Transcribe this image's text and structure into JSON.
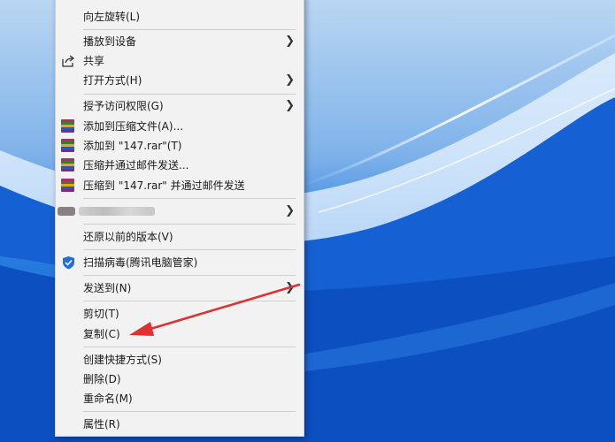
{
  "menu": {
    "rotate_left": "向左旋转(L)",
    "cast_to_device": "播放到设备",
    "share": "共享",
    "open_with": "打开方式(H)",
    "give_access": "授予访问权限(G)",
    "add_to_archive": "添加到压缩文件(A)...",
    "add_to_rar": "添加到 \"147.rar\"(T)",
    "compress_email": "压缩并通过邮件发送...",
    "compress_rar_email": "压缩到 \"147.rar\" 并通过邮件发送",
    "restore_versions": "还原以前的版本(V)",
    "scan_virus": "扫描病毒(腾讯电脑管家)",
    "send_to": "发送到(N)",
    "cut": "剪切(T)",
    "copy": "复制(C)",
    "create_shortcut": "创建快捷方式(S)",
    "delete": "删除(D)",
    "rename": "重命名(M)",
    "properties": "属性(R)"
  },
  "icons": {
    "share": "share-icon",
    "rar": "winrar-archive-icon",
    "shield": "tencent-shield-icon",
    "submenu": "chevron-right-icon"
  },
  "colors": {
    "desktop_blue": "#0a5fd0",
    "menu_bg": "#f2f2f2",
    "arrow_red": "#e03030",
    "shield_blue": "#1e6fd9"
  }
}
